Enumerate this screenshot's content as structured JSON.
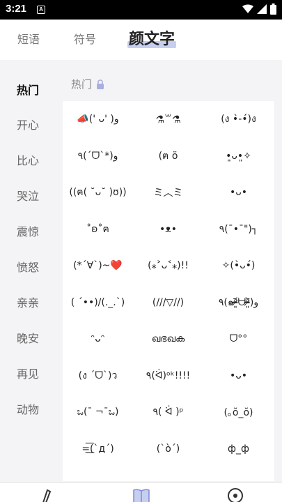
{
  "status_bar": {
    "time": "3:21",
    "notif_letter": "A"
  },
  "top_tabs": [
    {
      "label": "短语"
    },
    {
      "label": "符号"
    },
    {
      "label": "颜文字"
    }
  ],
  "sidebar": [
    {
      "label": "热门"
    },
    {
      "label": "开心"
    },
    {
      "label": "比心"
    },
    {
      "label": "哭泣"
    },
    {
      "label": "震惊"
    },
    {
      "label": "愤怒"
    },
    {
      "label": "亲亲"
    },
    {
      "label": "晚安"
    },
    {
      "label": "再见"
    },
    {
      "label": "动物"
    }
  ],
  "section_title": "热门",
  "kaomoji": [
    [
      "📣(' ᴗ' )و",
      "⚗︎꒳⚗︎",
      "(ง •̀-•́)ง"
    ],
    [
      "٩(ˊᗜˋ*)و",
      "(ฅ ö",
      "•͈ᴗ•͈✧"
    ],
    [
      "((ฅ( ˘ᴗ˘ )ʊ))",
      "ミ︿ミ",
      "•ᴗ•"
    ],
    [
      "˚ʚ˚ฅ",
      "•ᴥ•",
      "٩(¯•¯\")┐"
    ],
    [
      "(*´∀`)~❤️",
      "(⁎˃ᴗ˂⁎)!!",
      "✧(•̀ᴗ•́)"
    ],
    [
      "( ´••)/(._.`)",
      "(///▽//)",
      "٩(๑ᵒ̴̶̷͈᷄ᗨᵒ̴̶̷͈᷅)و"
    ],
    [
      "ᵔᴗᵔ",
      "ഖഭഖക",
      "ᗜ°°"
    ],
    [
      "(ง ˊᗜˋ)ว",
      "٩(ᐛ)ᵒᵏ!!!!",
      "•ᴗ•"
    ],
    [
      "ಒ(¯ ¬¯ಒ)",
      "٩( ᐛ )ᵖ",
      "(｡ŏ_ŏ)"
    ],
    [
      "=͟͟͞(`дˊ)",
      "(`ò´)",
      "ф_ф"
    ]
  ]
}
